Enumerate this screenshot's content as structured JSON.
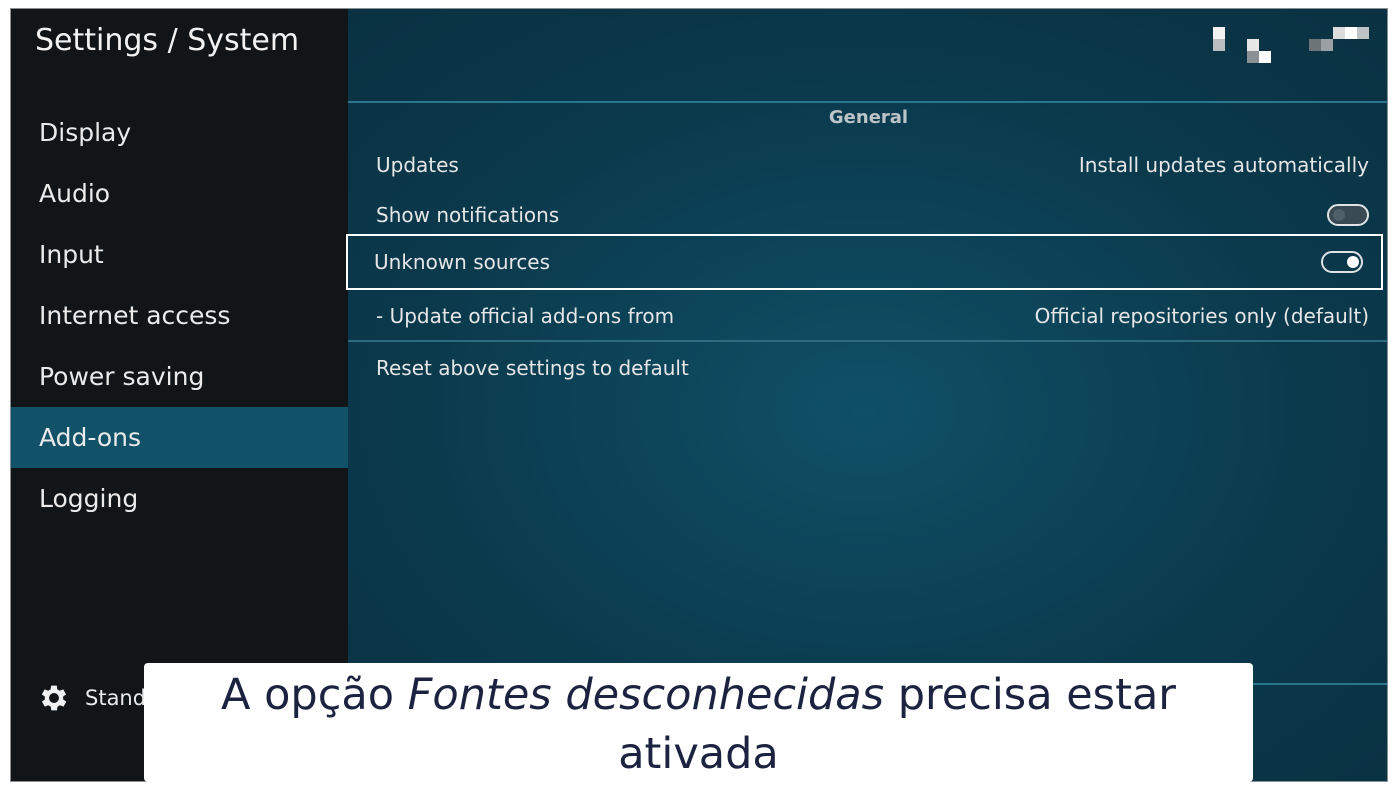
{
  "window": {
    "title": "Settings / System"
  },
  "sidebar": {
    "items": [
      {
        "label": "Display"
      },
      {
        "label": "Audio"
      },
      {
        "label": "Input"
      },
      {
        "label": "Internet access"
      },
      {
        "label": "Power saving"
      },
      {
        "label": "Add-ons",
        "selected": true
      },
      {
        "label": "Logging"
      }
    ],
    "footer": {
      "icon": "gear-icon",
      "label": "Standa"
    }
  },
  "main": {
    "section_title": "General",
    "settings": [
      {
        "label": "Updates",
        "value": "Install updates automatically"
      },
      {
        "label": "Show notifications",
        "toggle": "off"
      },
      {
        "label": "Unknown sources",
        "toggle": "on",
        "focused": true
      },
      {
        "label": "- Update official add-ons from",
        "value": "Official repositories only (default)"
      }
    ],
    "reset_label": "Reset above settings to default"
  },
  "caption": {
    "prefix": "A opção ",
    "emphasis": "Fontes desconhecidas",
    "suffix": " precisa estar ativada"
  },
  "colors": {
    "sidebar_bg": "#121518",
    "selected_item": "#125268",
    "content_bg": "#0b3a4d",
    "caption_text": "#1c2340"
  }
}
